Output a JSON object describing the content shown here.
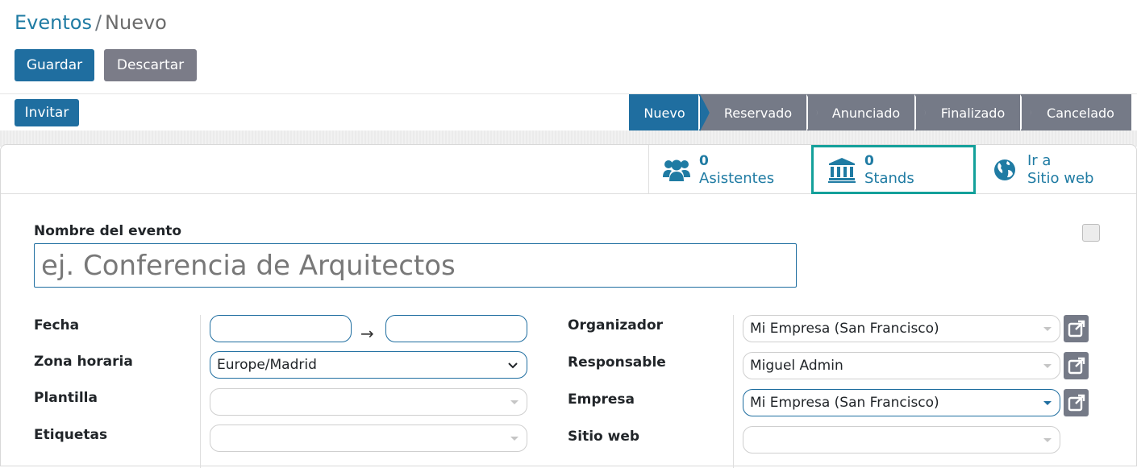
{
  "breadcrumb": {
    "parent": "Eventos",
    "separator": "/",
    "current": "Nuevo"
  },
  "actions": {
    "save": "Guardar",
    "discard": "Descartar"
  },
  "statusbar": {
    "invite": "Invitar",
    "stages": [
      "Nuevo",
      "Reservado",
      "Anunciado",
      "Finalizado",
      "Cancelado"
    ],
    "active_stage": "Nuevo"
  },
  "smart_buttons": {
    "attendees": {
      "count": "0",
      "label": "Asistentes",
      "icon": "users-icon"
    },
    "booths": {
      "count": "0",
      "label": "Stands",
      "icon": "bank-icon"
    },
    "website": {
      "line1": "Ir a",
      "line2": "Sitio web",
      "icon": "globe-icon"
    }
  },
  "form": {
    "name_label": "Nombre del evento",
    "name_placeholder": "ej. Conferencia de Arquitectos",
    "left": {
      "date_label": "Fecha",
      "date_arrow": "→",
      "timezone_label": "Zona horaria",
      "timezone_value": "Europe/Madrid",
      "template_label": "Plantilla",
      "tags_label": "Etiquetas"
    },
    "right": {
      "organizer_label": "Organizador",
      "organizer_value": "Mi Empresa (San Francisco)",
      "responsible_label": "Responsable",
      "responsible_value": "Miguel Admin",
      "company_label": "Empresa",
      "company_value": "Mi Empresa (San Francisco)",
      "website_label": "Sitio web"
    }
  },
  "colors": {
    "primary": "#1f6ea0",
    "link": "#1f7ba3",
    "secondary": "#757a87",
    "highlight": "#13a09a"
  }
}
